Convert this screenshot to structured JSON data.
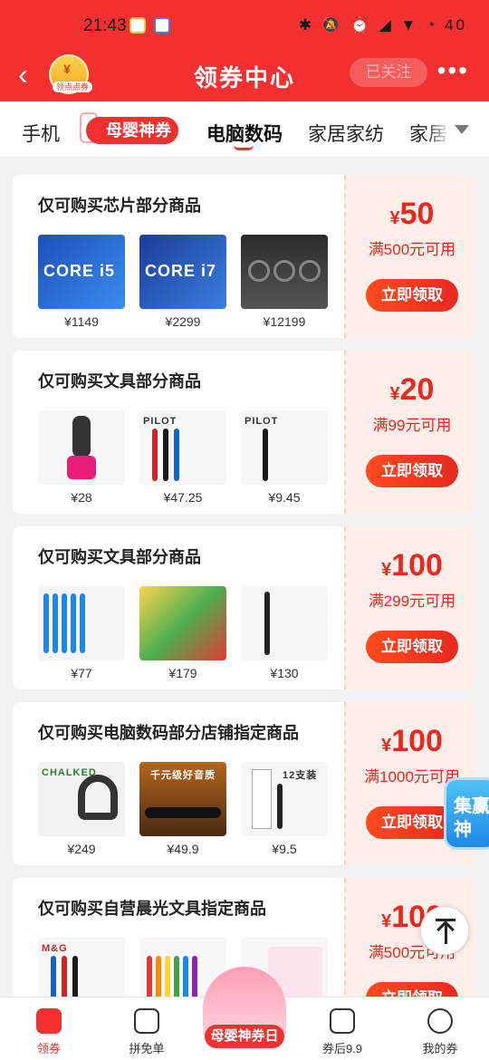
{
  "status_bar": {
    "time": "21:43",
    "battery": "40"
  },
  "header": {
    "back_icon": "chevron-left-icon",
    "logo_label": "领点点券",
    "title": "领券中心",
    "follow_label": "已关注",
    "more_icon": "more-dots-icon"
  },
  "tabs": [
    {
      "label": "手机"
    },
    {
      "label": "母婴神券",
      "special": true
    },
    {
      "label": "电脑数码",
      "active": true
    },
    {
      "label": "家居家纺"
    },
    {
      "label": "家居"
    }
  ],
  "coupons": [
    {
      "title": "仅可购买芯片部分商品",
      "currency": "¥",
      "amount": "50",
      "condition": "满500元可用",
      "button": "立即领取",
      "products": [
        {
          "img": "CORE i5",
          "price": "¥1149"
        },
        {
          "img": "CORE i7",
          "price": "¥2299"
        },
        {
          "img": "",
          "price": "¥12199"
        }
      ]
    },
    {
      "title": "仅可购买文具部分商品",
      "currency": "¥",
      "amount": "20",
      "condition": "满99元可用",
      "button": "立即领取",
      "products": [
        {
          "img": "",
          "price": "¥28"
        },
        {
          "img": "PILOT",
          "price": "¥47.25"
        },
        {
          "img": "PILOT",
          "price": "¥9.45"
        }
      ]
    },
    {
      "title": "仅可购买文具部分商品",
      "currency": "¥",
      "amount": "100",
      "condition": "满299元可用",
      "button": "立即领取",
      "products": [
        {
          "img": "",
          "price": "¥77"
        },
        {
          "img": "",
          "price": "¥179"
        },
        {
          "img": "",
          "price": "¥130"
        }
      ]
    },
    {
      "title": "仅可购买电脑数码部分店铺指定商品",
      "currency": "¥",
      "amount": "100",
      "condition": "满1000元可用",
      "button": "立即领取",
      "products": [
        {
          "img": "CHALKED",
          "price": "¥249"
        },
        {
          "img": "千元级好音质",
          "price": "¥49.9"
        },
        {
          "img": "12支装",
          "price": "¥9.5"
        }
      ]
    },
    {
      "title": "仅可购买自营晨光文具指定商品",
      "currency": "¥",
      "amount": "100",
      "condition": "满500元可用",
      "button": "立即领取",
      "products": [
        {
          "img": "M&G",
          "price": ""
        },
        {
          "img": "",
          "price": ""
        },
        {
          "img": "",
          "price": ""
        }
      ]
    }
  ],
  "float_badge": "集赢神",
  "bottom_nav": [
    {
      "label": "领券",
      "active": true
    },
    {
      "label": "拼免单"
    },
    {
      "label": "母婴神券日",
      "center": true
    },
    {
      "label": "券后9.9"
    },
    {
      "label": "我的券"
    }
  ],
  "colors": {
    "brand": "#f23030",
    "accent_text": "#e8291f",
    "coupon_bg": "#fdeeea"
  }
}
